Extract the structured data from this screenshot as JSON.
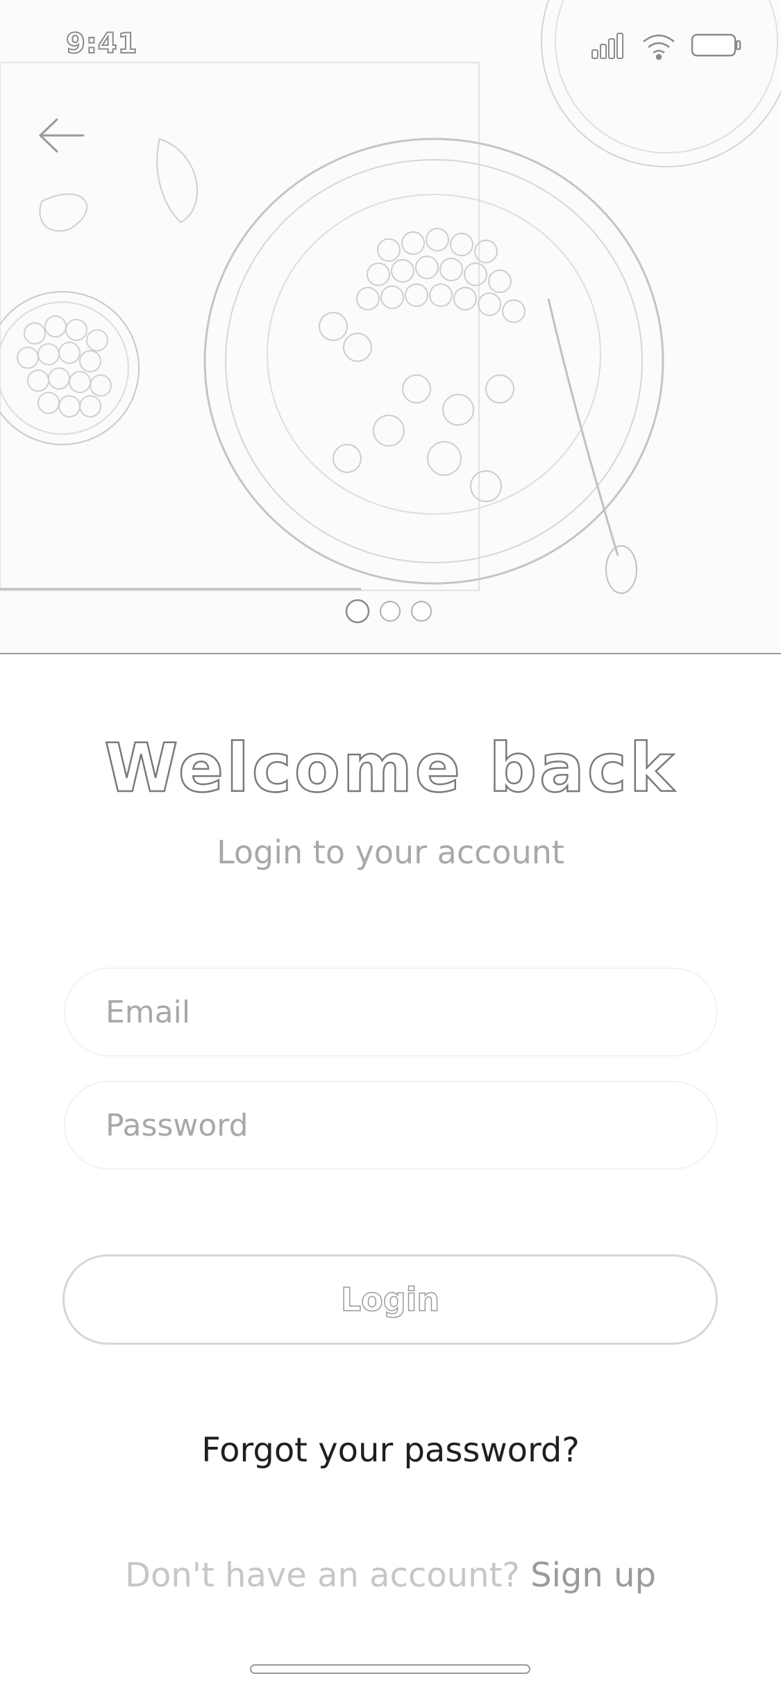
{
  "status_bar": {
    "time": "9:41",
    "icons": [
      "cellular-signal-icon",
      "wifi-icon",
      "battery-icon"
    ]
  },
  "header": {
    "back_icon": "back-arrow-icon",
    "carousel": {
      "page_count": 3,
      "active_index": 0
    }
  },
  "login": {
    "title": "Welcome back",
    "subtitle": "Login to your account",
    "email_placeholder": "Email",
    "email_value": "",
    "password_placeholder": "Password",
    "password_value": "",
    "login_label": "Login",
    "forgot_label": "Forgot your password?",
    "no_account_text": "Don't have an account? ",
    "signup_label": "Sign up"
  },
  "colors": {
    "background": "#ffffff",
    "muted_text": "#a8a8a8",
    "dark_text": "#1f1f1f",
    "outline": "#9a9a9a"
  }
}
